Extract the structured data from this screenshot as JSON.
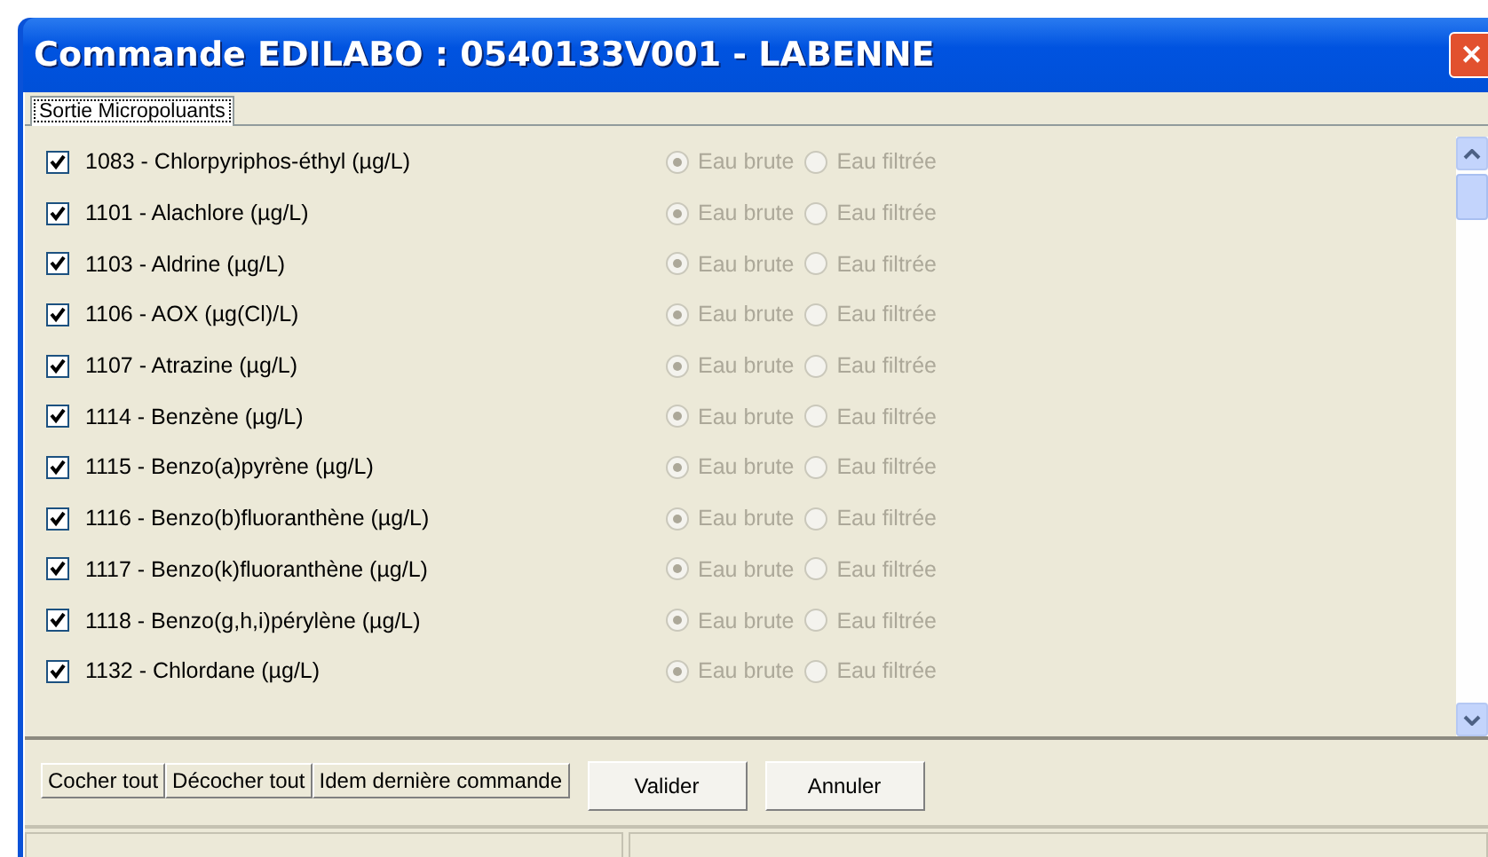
{
  "window": {
    "title": "Commande EDILABO : 0540133V001 - LABENNE",
    "close": "✕"
  },
  "tabs": [
    {
      "label": "Sortie Micropoluants",
      "selected": true
    }
  ],
  "rows": [
    {
      "label": "1083 - Chlorpyriphos-éthyl (µg/L)",
      "checked": true,
      "disabled": true,
      "options": [
        {
          "label": "Eau brute",
          "selected": true
        },
        {
          "label": "Eau filtrée",
          "selected": false
        }
      ]
    },
    {
      "label": "1101 - Alachlore (µg/L)",
      "checked": true,
      "disabled": true,
      "options": [
        {
          "label": "Eau brute",
          "selected": true
        },
        {
          "label": "Eau filtrée",
          "selected": false
        }
      ]
    },
    {
      "label": "1103 - Aldrine (µg/L)",
      "checked": true,
      "disabled": true,
      "options": [
        {
          "label": "Eau brute",
          "selected": true
        },
        {
          "label": "Eau filtrée",
          "selected": false
        }
      ]
    },
    {
      "label": "1106 - AOX (µg(Cl)/L)",
      "checked": true,
      "disabled": true,
      "options": [
        {
          "label": "Eau brute",
          "selected": true
        },
        {
          "label": "Eau filtrée",
          "selected": false
        }
      ]
    },
    {
      "label": "1107 - Atrazine (µg/L)",
      "checked": true,
      "disabled": true,
      "options": [
        {
          "label": "Eau brute",
          "selected": true
        },
        {
          "label": "Eau filtrée",
          "selected": false
        }
      ]
    },
    {
      "label": "1114 - Benzène (µg/L)",
      "checked": true,
      "disabled": true,
      "options": [
        {
          "label": "Eau brute",
          "selected": true
        },
        {
          "label": "Eau filtrée",
          "selected": false
        }
      ]
    },
    {
      "label": "1115 - Benzo(a)pyrène (µg/L)",
      "checked": true,
      "disabled": true,
      "options": [
        {
          "label": "Eau brute",
          "selected": true
        },
        {
          "label": "Eau filtrée",
          "selected": false
        }
      ]
    },
    {
      "label": "1116 - Benzo(b)fluoranthène (µg/L)",
      "checked": true,
      "disabled": true,
      "options": [
        {
          "label": "Eau brute",
          "selected": true
        },
        {
          "label": "Eau filtrée",
          "selected": false
        }
      ]
    },
    {
      "label": "1117 - Benzo(k)fluoranthène (µg/L)",
      "checked": true,
      "disabled": true,
      "options": [
        {
          "label": "Eau brute",
          "selected": true
        },
        {
          "label": "Eau filtrée",
          "selected": false
        }
      ]
    },
    {
      "label": "1118 - Benzo(g,h,i)pérylène (µg/L)",
      "checked": true,
      "disabled": true,
      "options": [
        {
          "label": "Eau brute",
          "selected": true
        },
        {
          "label": "Eau filtrée",
          "selected": false
        }
      ]
    },
    {
      "label": "1132 - Chlordane (µg/L)",
      "checked": true,
      "disabled": true,
      "options": [
        {
          "label": "Eau brute",
          "selected": true
        },
        {
          "label": "Eau filtrée",
          "selected": false
        }
      ]
    }
  ],
  "tool_buttons": [
    "Cocher tout",
    "Décocher tout",
    "Idem dernière commande"
  ],
  "buttons": [
    "Valider",
    "Annuler"
  ]
}
